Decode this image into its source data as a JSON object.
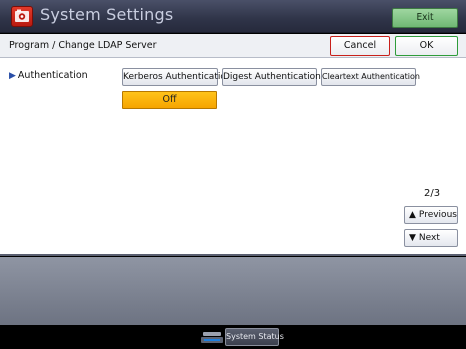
{
  "window": {
    "title": "System Settings",
    "exit_label": "Exit"
  },
  "subheader": {
    "title": "Program / Change LDAP Server",
    "cancel_label": "Cancel",
    "ok_label": "OK"
  },
  "setting": {
    "label": "Authentication",
    "options": [
      "Kerberos Authentication",
      "Digest Authentication",
      "Cleartext Authentication"
    ],
    "selected_label": "Off"
  },
  "pager": {
    "text": "2/3",
    "previous_label": "Previous",
    "next_label": "Next"
  },
  "footer": {
    "system_status_label": "System Status"
  },
  "colors": {
    "selected": "#f6a400",
    "ok_border": "#2e9c3a",
    "cancel_border": "#c8201a",
    "exit_button": "#6fb874"
  }
}
